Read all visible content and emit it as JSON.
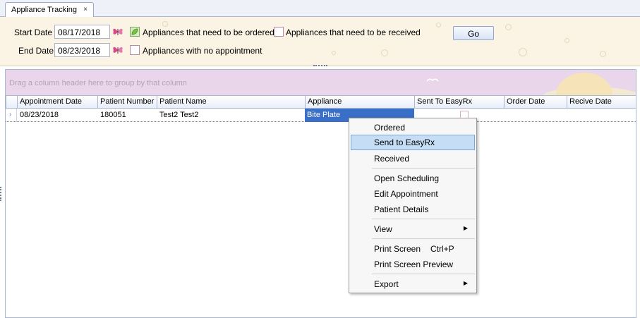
{
  "tab": {
    "title": "Appliance Tracking",
    "close": "×"
  },
  "filters": {
    "start_label": "Start Date",
    "start_value": "08/17/2018",
    "end_label": "End Date",
    "end_value": "08/23/2018",
    "opt_ordered": "Appliances that need to be ordered",
    "opt_ordered_checked": true,
    "opt_received": "Appliances that need to be received",
    "opt_received_checked": false,
    "opt_no_appt": "Appliances with no appointment",
    "opt_no_appt_checked": false,
    "go": "Go"
  },
  "grid": {
    "group_hint": "Drag a column header here to group by that column",
    "columns": [
      "Appointment Date",
      "Patient Number",
      "Patient Name",
      "Appliance",
      "Sent To EasyRx",
      "Order Date",
      "Recive Date"
    ],
    "rows": [
      {
        "appointment_date": "08/23/2018",
        "patient_number": "180051",
        "patient_name": "Test2 Test2",
        "appliance": "Bite Plate",
        "sent_to_easyrx": false,
        "order_date": "",
        "recive_date": ""
      }
    ]
  },
  "context_menu": {
    "items": [
      {
        "label": "Ordered"
      },
      {
        "label": "Send to EasyRx",
        "highlighted": true
      },
      {
        "label": "Received"
      },
      {
        "label": "Open Scheduling"
      },
      {
        "label": "Edit Appointment"
      },
      {
        "label": "Patient Details"
      },
      {
        "label": "View",
        "submenu": true
      },
      {
        "label": "Print Screen",
        "shortcut": "Ctrl+P"
      },
      {
        "label": "Print Screen Preview"
      },
      {
        "label": "Export",
        "submenu": true
      }
    ],
    "submenu_arrow": "▶"
  },
  "colors": {
    "selection": "#3a6fc7",
    "menu_highlight": "#c5def5",
    "filter_bg": "#fbf4e4",
    "groupbar_bg": "#ead6ea"
  },
  "icons": {
    "calendar": "butterfly-calendar-icon",
    "row_indicator": "›"
  }
}
